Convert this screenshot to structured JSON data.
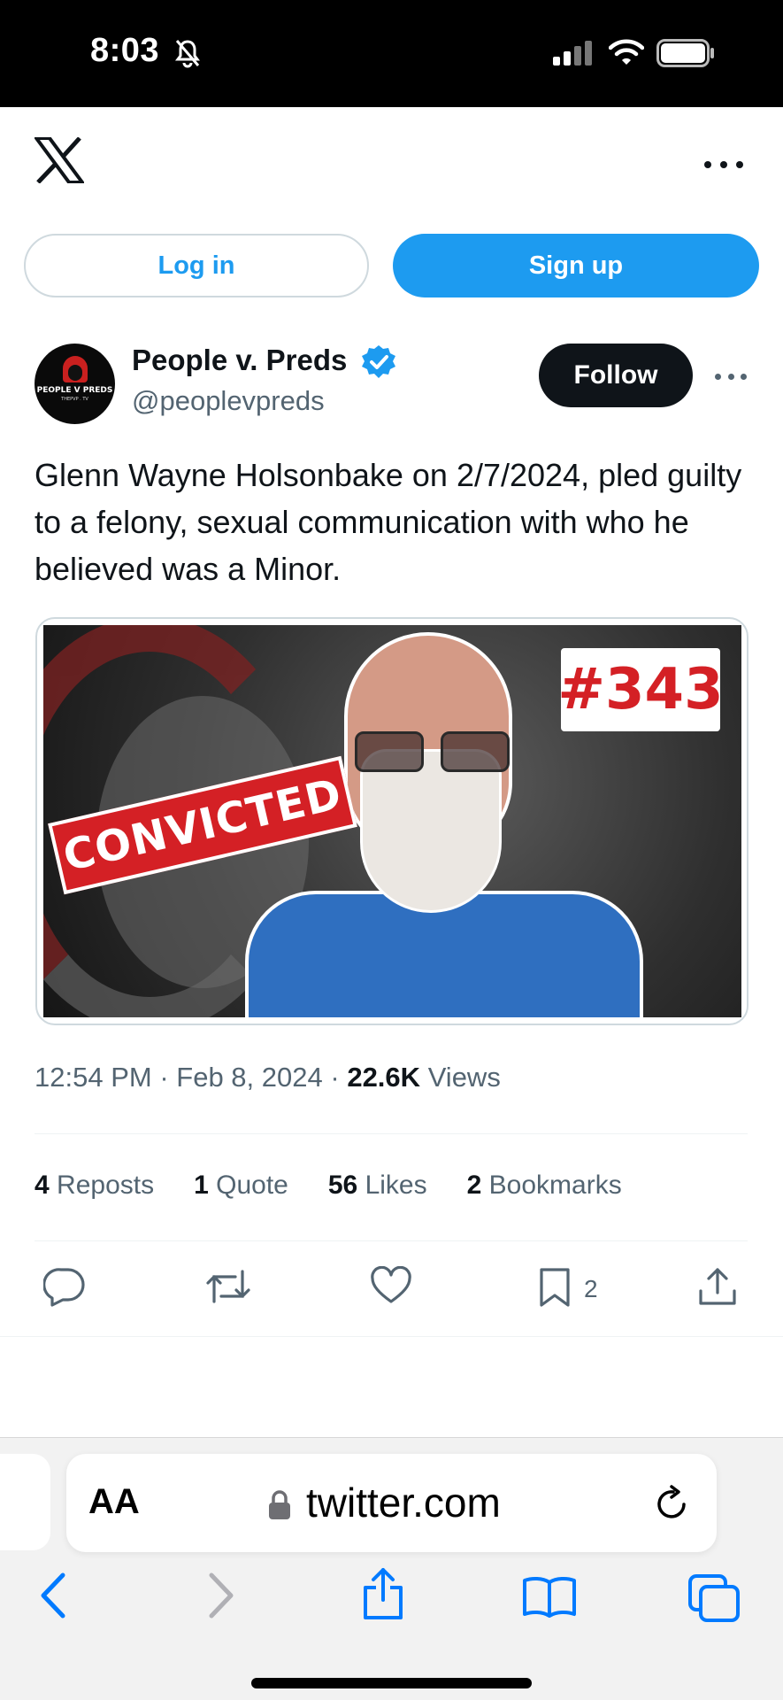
{
  "status_bar": {
    "time": "8:03",
    "icons": [
      "bell-slash-icon",
      "signal-icon",
      "wifi-icon",
      "battery-icon"
    ]
  },
  "header": {
    "logo": "x-logo-icon",
    "more_icon": "more-horizontal-icon"
  },
  "auth": {
    "login_label": "Log in",
    "signup_label": "Sign up"
  },
  "tweet": {
    "author": {
      "name": "People v. Preds",
      "handle": "@peoplevpreds",
      "verified": true,
      "avatar_text": "PEOPLE V PREDS",
      "avatar_subtext": "THEPVP . TV"
    },
    "follow_label": "Follow",
    "text": "Glenn Wayne Holsonbake on 2/7/2024, pled guilty to a felony, sexual communication with who he believed was a Minor.",
    "media": {
      "badge_number": "#343",
      "stamp_text": "CONVICTED"
    },
    "meta": {
      "time": "12:54 PM",
      "date": "Feb 8, 2024",
      "separator": "·",
      "views_count": "22.6K",
      "views_label": "Views"
    },
    "stats": [
      {
        "count": "4",
        "label": "Reposts"
      },
      {
        "count": "1",
        "label": "Quote"
      },
      {
        "count": "56",
        "label": "Likes"
      },
      {
        "count": "2",
        "label": "Bookmarks"
      }
    ],
    "actions": {
      "bookmark_count": "2",
      "icons": [
        "reply-icon",
        "repost-icon",
        "like-icon",
        "bookmark-icon",
        "share-icon"
      ]
    }
  },
  "browser": {
    "text_size_label": "AA",
    "url": "twitter.com",
    "accent_color": "#007aff"
  },
  "colors": {
    "brand_blue": "#1d9bf0",
    "text_primary": "#0f1419",
    "text_secondary": "#536471",
    "stamp_red": "#d42025"
  }
}
